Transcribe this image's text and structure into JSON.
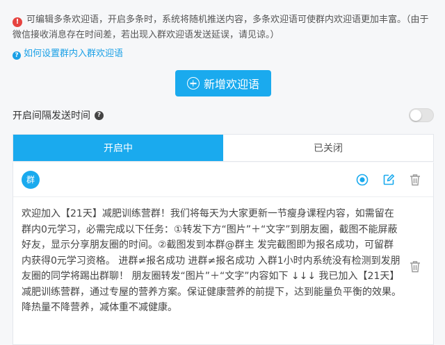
{
  "notice": {
    "text": "可编辑多条欢迎语，开启多条时，系统将随机推送内容，多条欢迎语可使群内欢迎语更加丰富。（由于微信接收消息存在时间差，若出现入群欢迎语发送延误，请见谅。）"
  },
  "help_link": {
    "label": "如何设置群内入群欢迎语"
  },
  "add_button": {
    "label": "新增欢迎语"
  },
  "interval": {
    "label": "开启间隔发送时间",
    "enabled": false
  },
  "tabs": [
    {
      "label": "开启中",
      "active": true
    },
    {
      "label": "已关闭",
      "active": false
    }
  ],
  "card": {
    "badge": "群",
    "message": "欢迎加入【21天】减肥训练营群！我们将每天为大家更新一节瘦身课程内容，如需留在群内0元学习，必需完成以下任务：①转发下方“图片”＋“文字”到朋友圈，截图不能屏蔽好友，显示分享朋友圈的时间。②截图发到本群@群主 发完截图即为报名成功，可留群内获得0元学习资格。 进群≠报名成功 进群≠报名成功 入群1小时内系统没有检测到发朋友圈的同学将踢出群聊！ 朋友圈转发“图片”＋“文字”内容如下 ↓↓↓ 我已加入【21天】减肥训练营群，通过专屋的营养方案。保证健康营养的前提下，达到能量负平衡的效果。降热量不降营养，减体重不减健康。"
  },
  "colors": {
    "accent": "#1aaaee",
    "alert": "#e64340",
    "link": "#1aa0e6"
  }
}
